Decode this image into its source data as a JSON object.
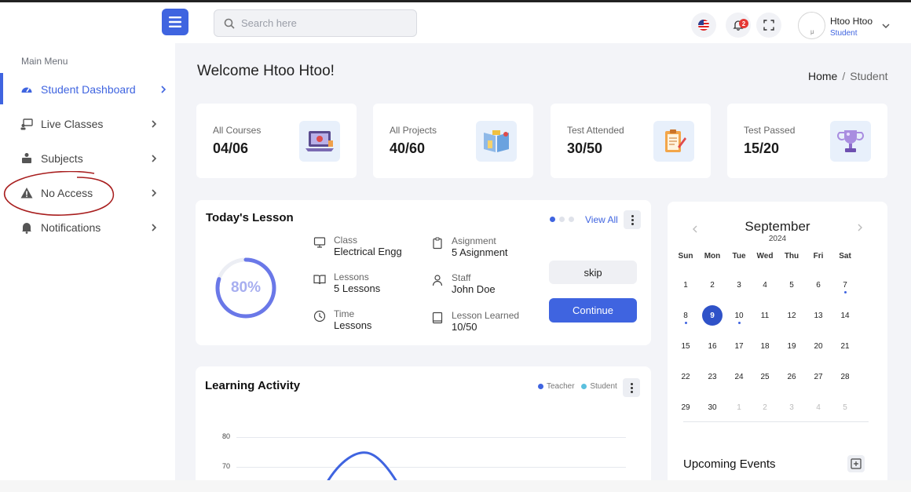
{
  "header": {
    "search_placeholder": "Search here",
    "notification_count": "2",
    "user_name": "Htoo Htoo",
    "user_role": "Student",
    "avatar_alt": "μ"
  },
  "sidebar": {
    "title": "Main Menu",
    "items": [
      {
        "label": "Student Dashboard",
        "icon": "dashboard-icon"
      },
      {
        "label": "Live Classes",
        "icon": "live-classes-icon"
      },
      {
        "label": "Subjects",
        "icon": "subjects-icon"
      },
      {
        "label": "No Access",
        "icon": "warning-icon"
      },
      {
        "label": "Notifications",
        "icon": "bell-icon"
      }
    ]
  },
  "page": {
    "welcome": "Welcome Htoo Htoo!",
    "breadcrumb": [
      "Home",
      "/",
      "Student"
    ]
  },
  "stats": [
    {
      "label": "All Courses",
      "value": "04/06",
      "icon": "laptop-icon"
    },
    {
      "label": "All Projects",
      "value": "40/60",
      "icon": "book-icon"
    },
    {
      "label": "Test Attended",
      "value": "30/50",
      "icon": "clipboard-icon"
    },
    {
      "label": "Test Passed",
      "value": "15/20",
      "icon": "trophy-icon"
    }
  ],
  "lesson": {
    "title": "Today's Lesson",
    "view_all": "View All",
    "progress_label": "80%",
    "progress": 0.8,
    "items": [
      {
        "label": "Class",
        "value": "Electrical Engg",
        "icon": "monitor-icon"
      },
      {
        "label": "Asignment",
        "value": "5 Asignment",
        "icon": "clipboard-icon"
      },
      {
        "label": "Lessons",
        "value": "5 Lessons",
        "icon": "open-book-icon"
      },
      {
        "label": "Staff",
        "value": "John Doe",
        "icon": "person-icon"
      },
      {
        "label": "Time",
        "value": "Lessons",
        "icon": "clock-icon"
      },
      {
        "label": "Lesson Learned",
        "value": "10/50",
        "icon": "book-icon"
      }
    ],
    "skip": "skip",
    "continue": "Continue"
  },
  "activity": {
    "title": "Learning Activity",
    "legend": [
      {
        "name": "Teacher",
        "color": "#3f64e0"
      },
      {
        "name": "Student",
        "color": "#5bc0de"
      }
    ],
    "y_ticks": [
      "80",
      "70"
    ]
  },
  "calendar": {
    "month": "September",
    "year": "2024",
    "weekdays": [
      "Sun",
      "Mon",
      "Tue",
      "Wed",
      "Thu",
      "Fri",
      "Sat"
    ],
    "weeks": [
      [
        "1",
        "2",
        "3",
        "4",
        "5",
        "6",
        "7"
      ],
      [
        "8",
        "9",
        "10",
        "11",
        "12",
        "13",
        "14"
      ],
      [
        "15",
        "16",
        "17",
        "18",
        "19",
        "20",
        "21"
      ],
      [
        "22",
        "23",
        "24",
        "25",
        "26",
        "27",
        "28"
      ],
      [
        "29",
        "30",
        "1",
        "2",
        "3",
        "4",
        "5"
      ]
    ],
    "selected": "9"
  },
  "events": {
    "title": "Upcoming Events"
  },
  "colors": {
    "accent": "#3f64e0",
    "badge": "#e53935"
  }
}
